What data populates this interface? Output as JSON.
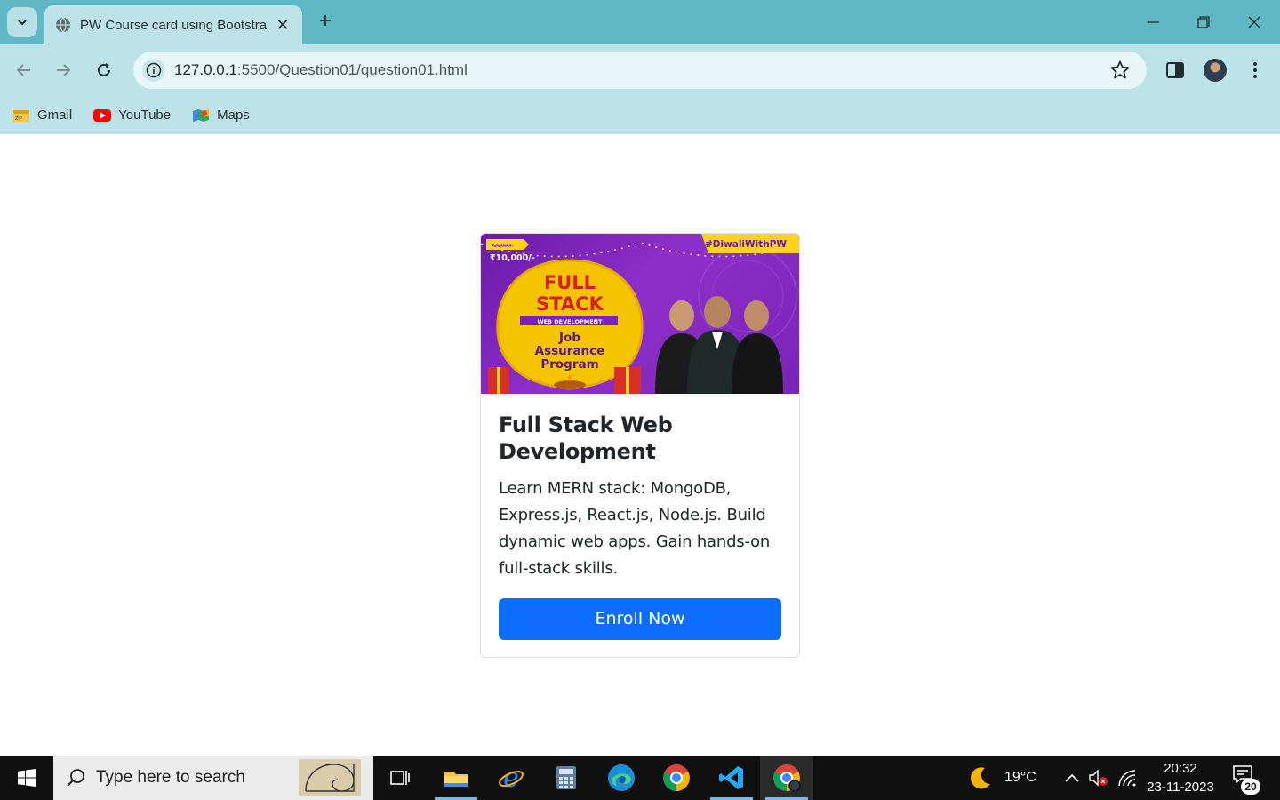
{
  "browser": {
    "tab_title": "PW Course card using Bootstrap",
    "url_host": "127.0.0.1",
    "url_path": ":5500/Question01/question01.html",
    "bookmarks": [
      {
        "label": "Gmail",
        "icon": "gmail-icon"
      },
      {
        "label": "YouTube",
        "icon": "youtube-icon"
      },
      {
        "label": "Maps",
        "icon": "maps-icon"
      }
    ]
  },
  "banner": {
    "hashtag": "#DiwaliWithPW",
    "old_price": "₹20,000/-",
    "price": "₹10,000/-",
    "line1": "FULL",
    "line2": "STACK",
    "ribbon": "WEB DEVELOPMENT",
    "sub1": "Job",
    "sub2": "Assurance",
    "sub3": "Program"
  },
  "card": {
    "title": "Full Stack Web Development",
    "text": "Learn MERN stack: MongoDB, Express.js, React.js, Node.js. Build dynamic web apps. Gain hands-on full-stack skills.",
    "button": "Enroll Now"
  },
  "taskbar": {
    "search_placeholder": "Type here to search",
    "weather": "19°C",
    "time": "20:32",
    "date": "23-11-2023",
    "notifications": "20"
  },
  "colors": {
    "primary": "#0d6efd",
    "chrome": "#5fb8c4",
    "chrome_light": "#bde3e9"
  }
}
